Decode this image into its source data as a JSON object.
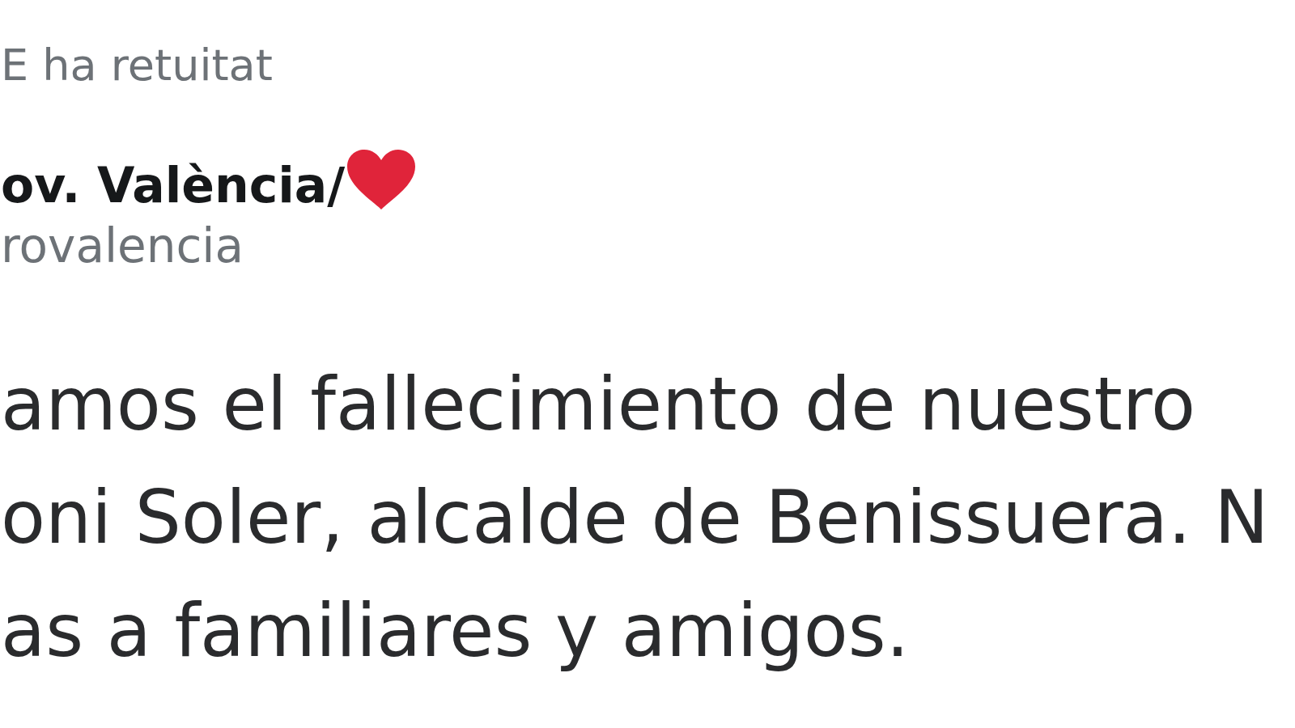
{
  "retweet_label": {
    "text": "E ha retuitat"
  },
  "author": {
    "name": "ov. València/",
    "handle": "rovalencia"
  },
  "tweet": {
    "lines": [
      "amos el fallecimiento de nuestro",
      "oni Soler, alcalde de Benissuera. N",
      "as a familiares y amigos."
    ]
  }
}
